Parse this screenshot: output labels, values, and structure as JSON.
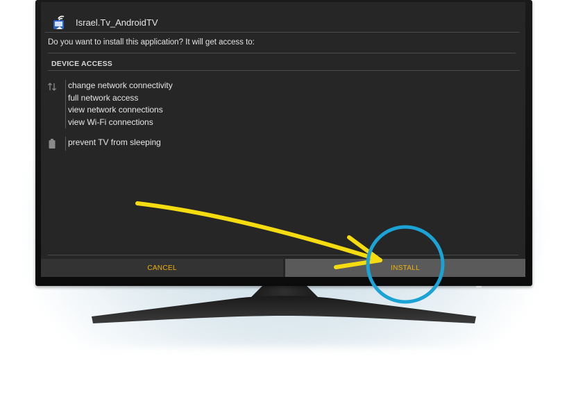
{
  "dialog": {
    "app_name": "Israel.Tv_AndroidTV",
    "prompt": "Do you want to install this application? It will get access to:",
    "section_header": "DEVICE ACCESS",
    "permission_groups": [
      {
        "icon": "network-arrows-icon",
        "items": [
          "change network connectivity",
          "full network access",
          "view network connections",
          "view Wi-Fi connections"
        ]
      },
      {
        "icon": "battery-icon",
        "items": [
          "prevent TV from sleeping"
        ]
      }
    ],
    "buttons": {
      "cancel_label": "CANCEL",
      "install_label": "INSTALL",
      "focused": "install"
    }
  },
  "colors": {
    "screen_background": "#262626",
    "button_text": "#f0b30c",
    "annotation_arrow": "#f5dc10",
    "annotation_circle": "#1aa3d4"
  }
}
